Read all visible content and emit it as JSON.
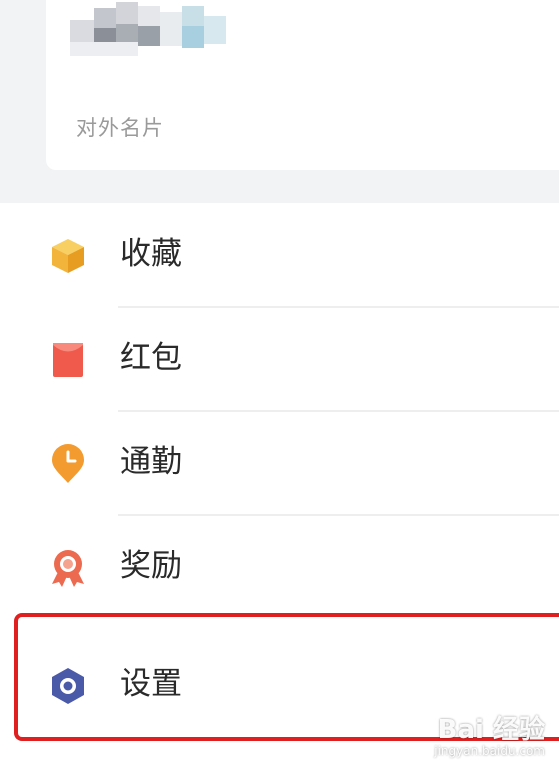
{
  "profile_card": {
    "card_link_label": "对外名片"
  },
  "menu": {
    "items": [
      {
        "label": "收藏",
        "icon": "cube-icon",
        "color": "#f2b43a"
      },
      {
        "label": "红包",
        "icon": "red-envelope-icon",
        "color": "#ef5a4c"
      },
      {
        "label": "通勤",
        "icon": "clock-pin-icon",
        "color": "#f39b2e"
      },
      {
        "label": "奖励",
        "icon": "medal-icon",
        "color": "#ec6a4f"
      },
      {
        "label": "设置",
        "icon": "hexagon-gear-icon",
        "color": "#4a5aa8"
      }
    ]
  },
  "highlight": {
    "color": "#e02020"
  },
  "watermark": {
    "brand": "Bai 经验",
    "url": "jingyan.baidu.com"
  }
}
